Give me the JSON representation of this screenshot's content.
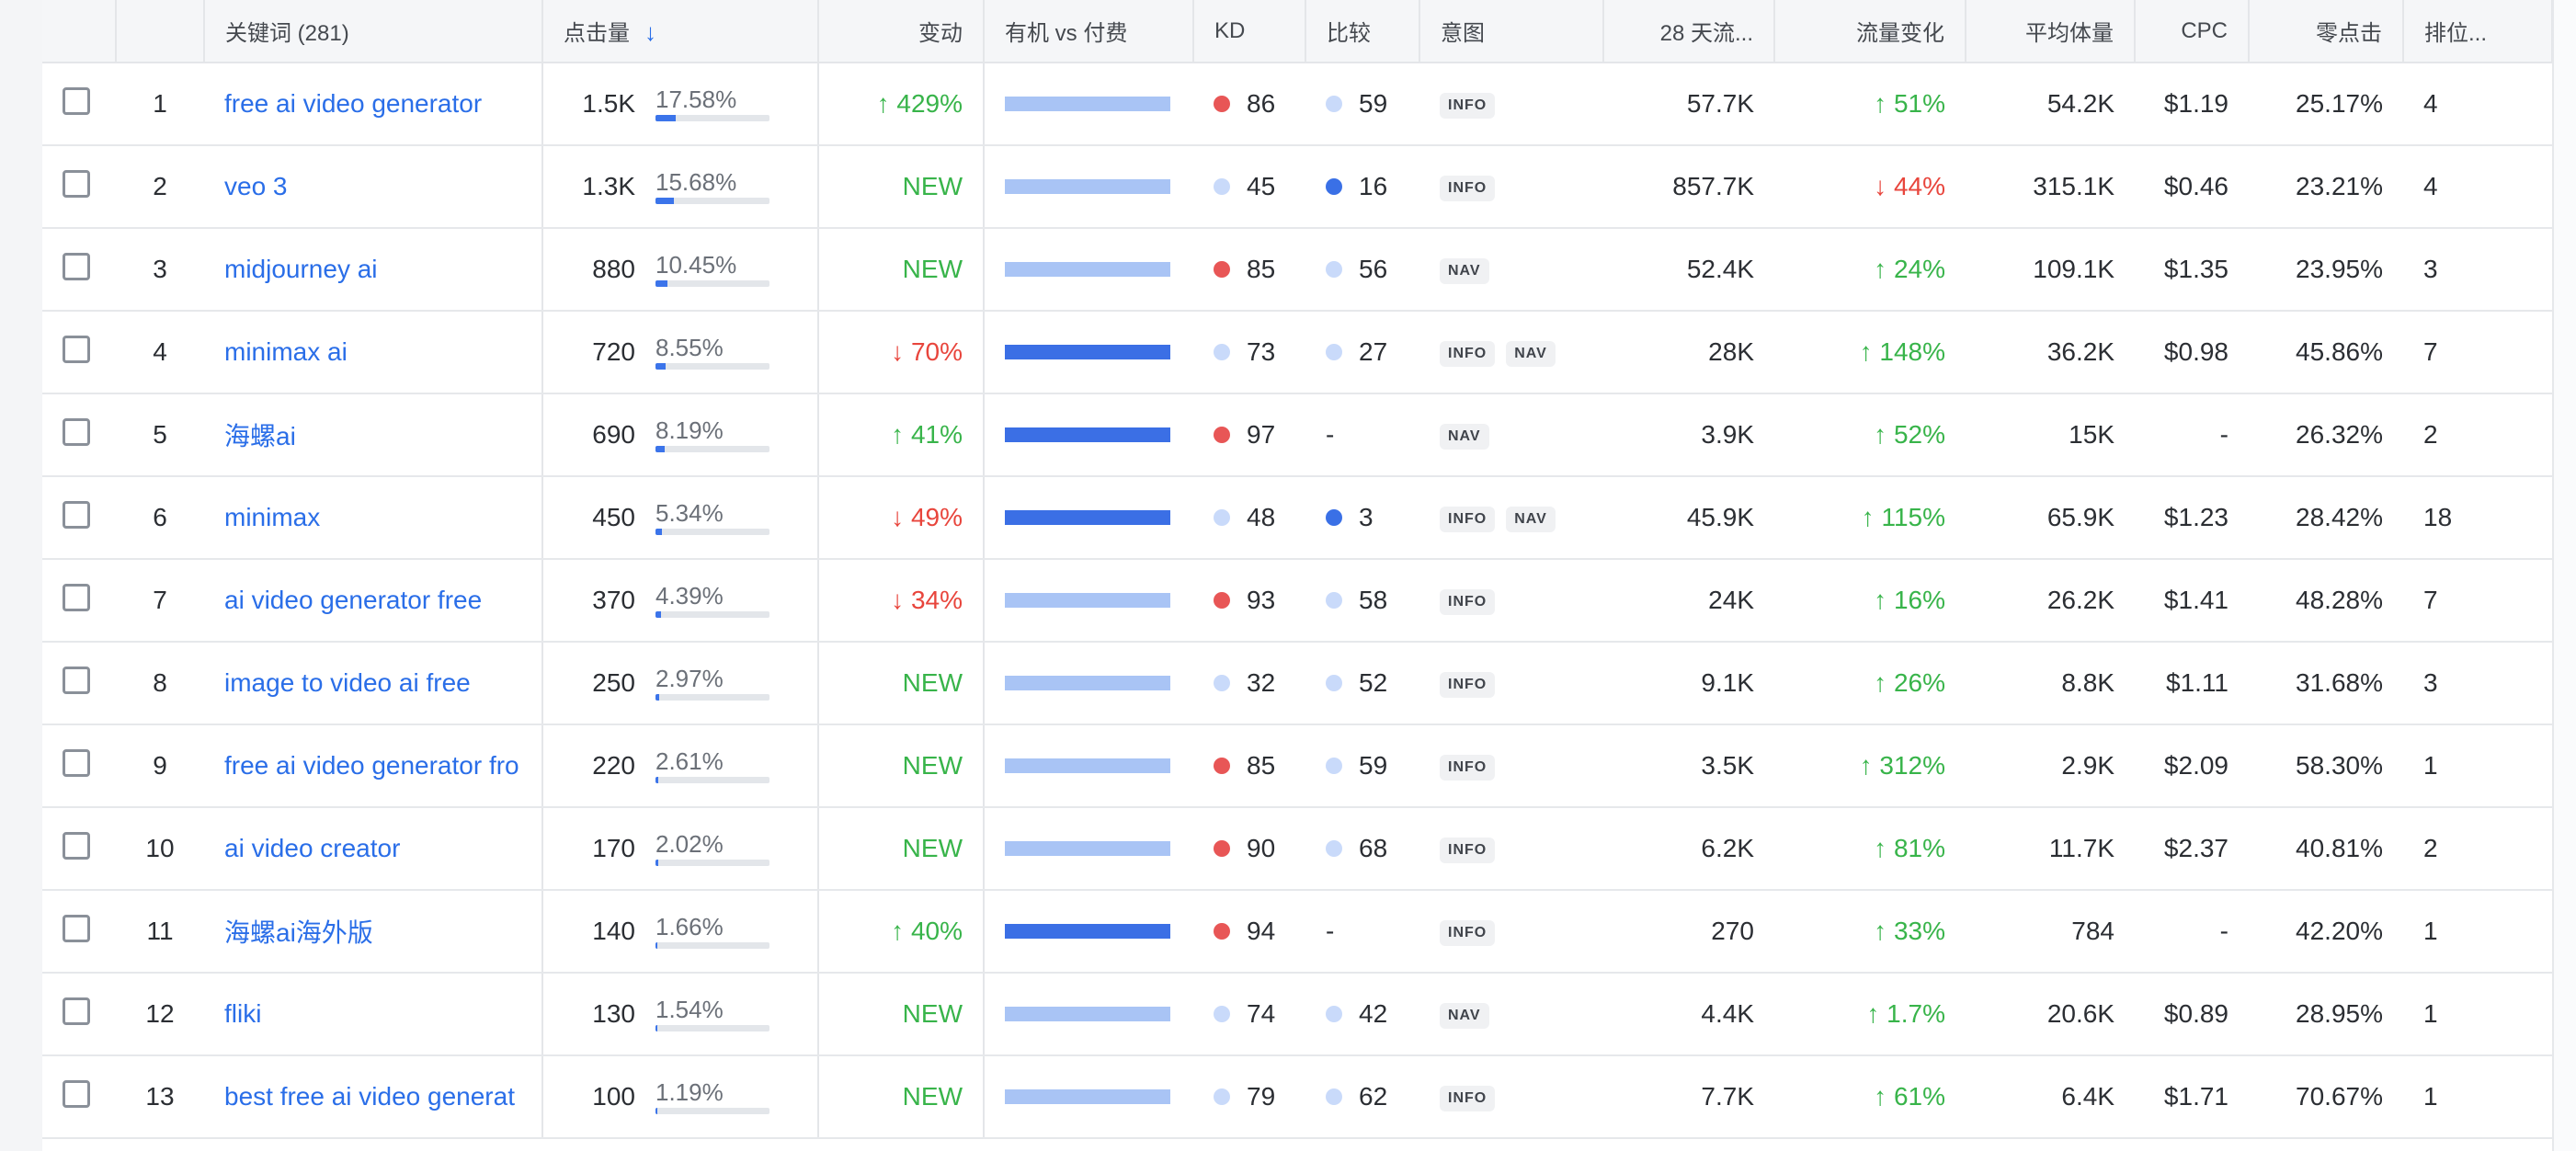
{
  "header": {
    "keyword": "关键词 (281)",
    "clicks": "点击量",
    "change": "变动",
    "organic_vs_paid": "有机 vs 付费",
    "kd": "KD",
    "compare": "比较",
    "intent": "意图",
    "traffic_28d": "28 天流...",
    "traffic_change": "流量变化",
    "avg_volume": "平均体量",
    "cpc": "CPC",
    "zero_click": "零点击",
    "rank": "排位..."
  },
  "colors": {
    "link": "#2a6ee8",
    "up": "#38b44a",
    "down": "#e8453c",
    "kd_high": "#e85656",
    "kd_low": "#c9dafa",
    "compare_dark": "#3a70e6",
    "bar_paid_light": "#a9c4f5",
    "bar_organic_dark": "#3b6fe5"
  },
  "rows": [
    {
      "idx": "1",
      "kw": "free ai video generator",
      "clicks": "1.5K",
      "share": "17.58%",
      "share_value": 17.58,
      "change": "↑ 429%",
      "change_type": "up",
      "bar": "light",
      "kd": "86",
      "kd_color": "red",
      "cmp": "59",
      "cmp_color": "light",
      "intents": [
        "INFO"
      ],
      "traffic": "57.7K",
      "traffic_change": "↑ 51%",
      "traffic_change_type": "up",
      "vol": "54.2K",
      "cpc": "$1.19",
      "zero": "25.17%",
      "rank": "4"
    },
    {
      "idx": "2",
      "kw": "veo 3",
      "clicks": "1.3K",
      "share": "15.68%",
      "share_value": 15.68,
      "change": "NEW",
      "change_type": "new",
      "bar": "light",
      "kd": "45",
      "kd_color": "light",
      "cmp": "16",
      "cmp_color": "blue",
      "intents": [
        "INFO"
      ],
      "traffic": "857.7K",
      "traffic_change": "↓ 44%",
      "traffic_change_type": "down",
      "vol": "315.1K",
      "cpc": "$0.46",
      "zero": "23.21%",
      "rank": "4"
    },
    {
      "idx": "3",
      "kw": "midjourney ai",
      "clicks": "880",
      "share": "10.45%",
      "share_value": 10.45,
      "change": "NEW",
      "change_type": "new",
      "bar": "light",
      "kd": "85",
      "kd_color": "red",
      "cmp": "56",
      "cmp_color": "light",
      "intents": [
        "NAV"
      ],
      "traffic": "52.4K",
      "traffic_change": "↑ 24%",
      "traffic_change_type": "up",
      "vol": "109.1K",
      "cpc": "$1.35",
      "zero": "23.95%",
      "rank": "3"
    },
    {
      "idx": "4",
      "kw": "minimax ai",
      "clicks": "720",
      "share": "8.55%",
      "share_value": 8.55,
      "change": "↓ 70%",
      "change_type": "down",
      "bar": "dark",
      "kd": "73",
      "kd_color": "light",
      "cmp": "27",
      "cmp_color": "light",
      "intents": [
        "INFO",
        "NAV"
      ],
      "traffic": "28K",
      "traffic_change": "↑ 148%",
      "traffic_change_type": "up",
      "vol": "36.2K",
      "cpc": "$0.98",
      "zero": "45.86%",
      "rank": "7"
    },
    {
      "idx": "5",
      "kw": "海螺ai",
      "clicks": "690",
      "share": "8.19%",
      "share_value": 8.19,
      "change": "↑ 41%",
      "change_type": "up",
      "bar": "dark",
      "kd": "97",
      "kd_color": "red",
      "cmp": "-",
      "cmp_color": "none",
      "intents": [
        "NAV"
      ],
      "traffic": "3.9K",
      "traffic_change": "↑ 52%",
      "traffic_change_type": "up",
      "vol": "15K",
      "cpc": "-",
      "zero": "26.32%",
      "rank": "2"
    },
    {
      "idx": "6",
      "kw": "minimax",
      "clicks": "450",
      "share": "5.34%",
      "share_value": 5.34,
      "change": "↓ 49%",
      "change_type": "down",
      "bar": "dark",
      "kd": "48",
      "kd_color": "light",
      "cmp": "3",
      "cmp_color": "blue",
      "intents": [
        "INFO",
        "NAV"
      ],
      "traffic": "45.9K",
      "traffic_change": "↑ 115%",
      "traffic_change_type": "up",
      "vol": "65.9K",
      "cpc": "$1.23",
      "zero": "28.42%",
      "rank": "18"
    },
    {
      "idx": "7",
      "kw": "ai video generator free",
      "clicks": "370",
      "share": "4.39%",
      "share_value": 4.39,
      "change": "↓ 34%",
      "change_type": "down",
      "bar": "light",
      "kd": "93",
      "kd_color": "red",
      "cmp": "58",
      "cmp_color": "light",
      "intents": [
        "INFO"
      ],
      "traffic": "24K",
      "traffic_change": "↑ 16%",
      "traffic_change_type": "up",
      "vol": "26.2K",
      "cpc": "$1.41",
      "zero": "48.28%",
      "rank": "7"
    },
    {
      "idx": "8",
      "kw": "image to video ai free",
      "clicks": "250",
      "share": "2.97%",
      "share_value": 2.97,
      "change": "NEW",
      "change_type": "new",
      "bar": "light",
      "kd": "32",
      "kd_color": "light",
      "cmp": "52",
      "cmp_color": "light",
      "intents": [
        "INFO"
      ],
      "traffic": "9.1K",
      "traffic_change": "↑ 26%",
      "traffic_change_type": "up",
      "vol": "8.8K",
      "cpc": "$1.11",
      "zero": "31.68%",
      "rank": "3"
    },
    {
      "idx": "9",
      "kw": "free ai video generator fro",
      "clicks": "220",
      "share": "2.61%",
      "share_value": 2.61,
      "change": "NEW",
      "change_type": "new",
      "bar": "light",
      "kd": "85",
      "kd_color": "red",
      "cmp": "59",
      "cmp_color": "light",
      "intents": [
        "INFO"
      ],
      "traffic": "3.5K",
      "traffic_change": "↑ 312%",
      "traffic_change_type": "up",
      "vol": "2.9K",
      "cpc": "$2.09",
      "zero": "58.30%",
      "rank": "1"
    },
    {
      "idx": "10",
      "kw": "ai video creator",
      "clicks": "170",
      "share": "2.02%",
      "share_value": 2.02,
      "change": "NEW",
      "change_type": "new",
      "bar": "light",
      "kd": "90",
      "kd_color": "red",
      "cmp": "68",
      "cmp_color": "light",
      "intents": [
        "INFO"
      ],
      "traffic": "6.2K",
      "traffic_change": "↑ 81%",
      "traffic_change_type": "up",
      "vol": "11.7K",
      "cpc": "$2.37",
      "zero": "40.81%",
      "rank": "2"
    },
    {
      "idx": "11",
      "kw": "海螺ai海外版",
      "clicks": "140",
      "share": "1.66%",
      "share_value": 1.66,
      "change": "↑ 40%",
      "change_type": "up",
      "bar": "dark",
      "kd": "94",
      "kd_color": "red",
      "cmp": "-",
      "cmp_color": "none",
      "intents": [
        "INFO"
      ],
      "traffic": "270",
      "traffic_change": "↑ 33%",
      "traffic_change_type": "up",
      "vol": "784",
      "cpc": "-",
      "zero": "42.20%",
      "rank": "1"
    },
    {
      "idx": "12",
      "kw": "fliki",
      "clicks": "130",
      "share": "1.54%",
      "share_value": 1.54,
      "change": "NEW",
      "change_type": "new",
      "bar": "light",
      "kd": "74",
      "kd_color": "light",
      "cmp": "42",
      "cmp_color": "light",
      "intents": [
        "NAV"
      ],
      "traffic": "4.4K",
      "traffic_change": "↑ 1.7%",
      "traffic_change_type": "up",
      "vol": "20.6K",
      "cpc": "$0.89",
      "zero": "28.95%",
      "rank": "1"
    },
    {
      "idx": "13",
      "kw": "best free ai video generat",
      "clicks": "100",
      "share": "1.19%",
      "share_value": 1.19,
      "change": "NEW",
      "change_type": "new",
      "bar": "light",
      "kd": "79",
      "kd_color": "light",
      "cmp": "62",
      "cmp_color": "light",
      "intents": [
        "INFO"
      ],
      "traffic": "7.7K",
      "traffic_change": "↑ 61%",
      "traffic_change_type": "up",
      "vol": "6.4K",
      "cpc": "$1.71",
      "zero": "70.67%",
      "rank": "1"
    }
  ]
}
